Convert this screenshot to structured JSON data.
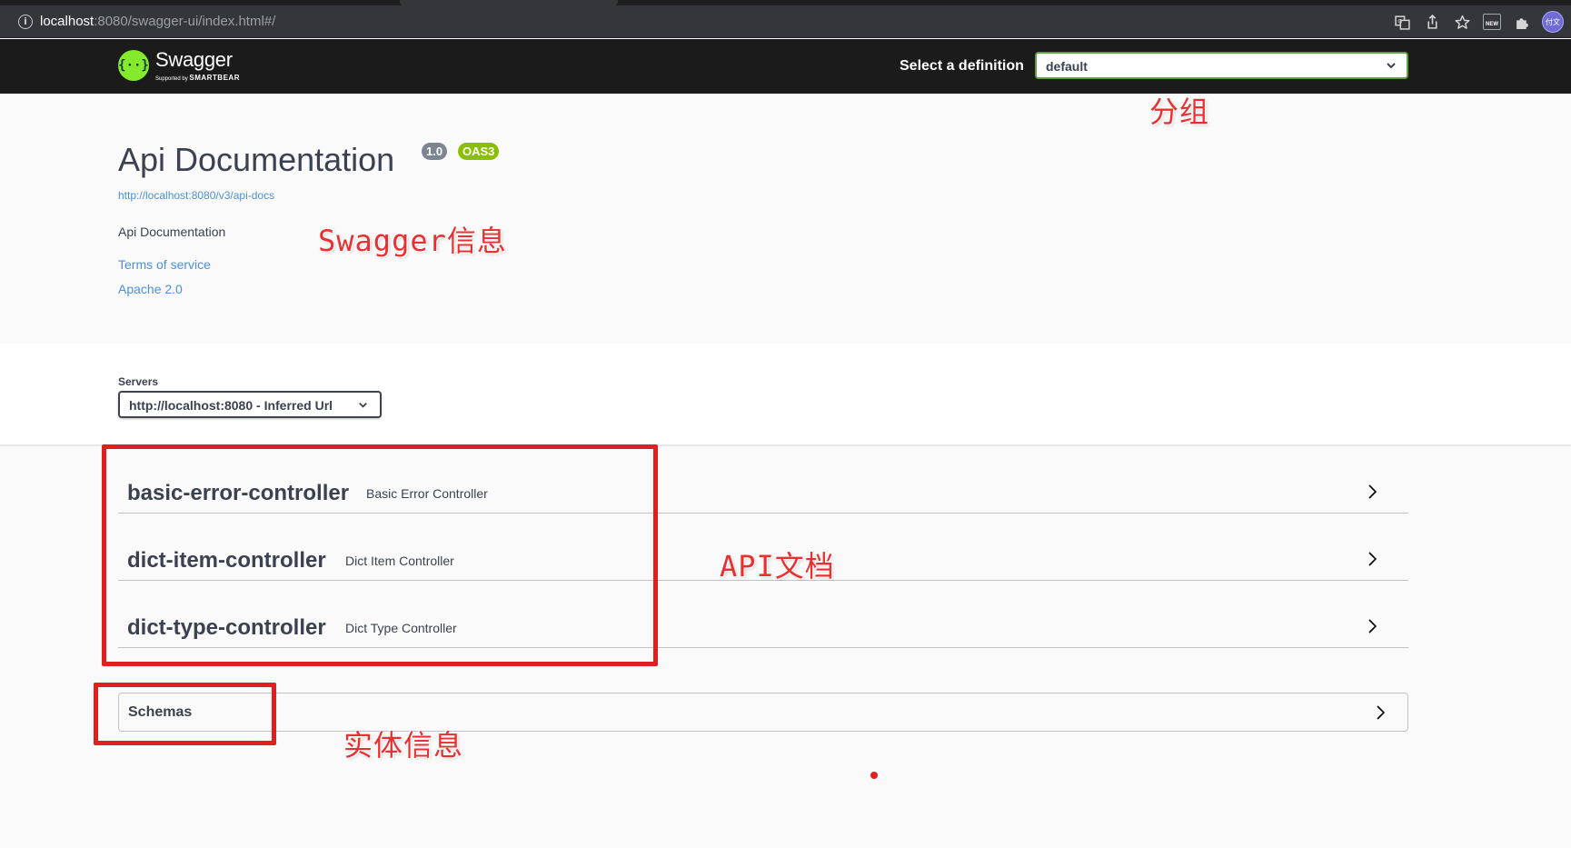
{
  "browser": {
    "url_host": "localhost",
    "url_rest": ":8080/swagger-ui/index.html#/",
    "avatar_text": "付文"
  },
  "topbar": {
    "logo_name": "Swagger",
    "logo_sub_small": "Supported by ",
    "logo_sub_brand": "SMARTBEAR",
    "definition_label": "Select a definition",
    "definition_value": "default"
  },
  "info": {
    "title": "Api Documentation",
    "version": "1.0",
    "oas": "OAS3",
    "api_docs_url": "http://localhost:8080/v3/api-docs",
    "description": "Api Documentation",
    "terms_link": "Terms of service",
    "license_link": "Apache 2.0"
  },
  "servers": {
    "label": "Servers",
    "selected": "http://localhost:8080 - Inferred Url"
  },
  "tags": [
    {
      "name": "basic-error-controller",
      "description": "Basic Error Controller"
    },
    {
      "name": "dict-item-controller",
      "description": "Dict Item Controller"
    },
    {
      "name": "dict-type-controller",
      "description": "Dict Type Controller"
    }
  ],
  "schemas": {
    "label": "Schemas"
  },
  "annotations": {
    "group": "分组",
    "swagger_info": "Swagger信息",
    "api_docs": "API文档",
    "entity_info": "实体信息",
    "color": "#e02020"
  },
  "colors": {
    "topbar_bg": "#1b1b1b",
    "accent_green": "#85ea2d",
    "link_blue": "#4990e2",
    "text_dark": "#3b4151",
    "oas_badge": "#89bf04",
    "version_badge": "#7d8492"
  }
}
